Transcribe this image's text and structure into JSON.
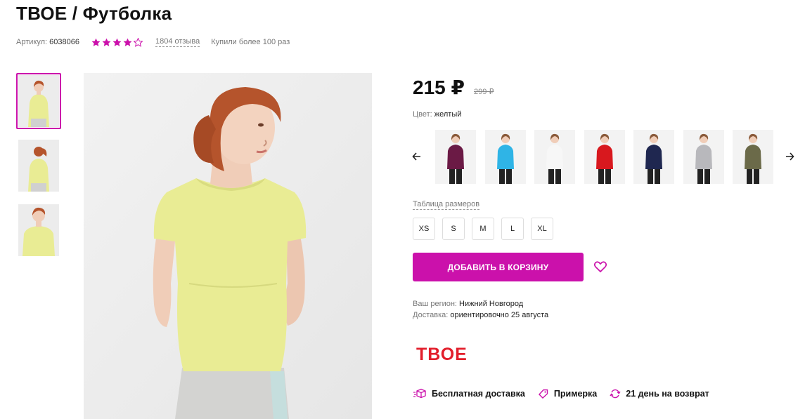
{
  "product": {
    "title": "ТВОЕ / Футболка",
    "article_label": "Артикул:",
    "article": "6038066",
    "rating": 4,
    "rating_max": 5,
    "reviews": "1804 отзыва",
    "bought": "Купили более 100 раз"
  },
  "price": {
    "current": "215 ₽",
    "old": "299 ₽"
  },
  "color": {
    "label": "Цвет:",
    "value": "желтый",
    "swatches": [
      {
        "name": "purple",
        "shirt": "#6b1a45"
      },
      {
        "name": "blue",
        "shirt": "#2fb4e6"
      },
      {
        "name": "white",
        "shirt": "#f7f7f7"
      },
      {
        "name": "red",
        "shirt": "#d8181e"
      },
      {
        "name": "navy",
        "shirt": "#1f2750"
      },
      {
        "name": "gray",
        "shirt": "#b8b8bc"
      },
      {
        "name": "khaki",
        "shirt": "#6b6a49"
      }
    ]
  },
  "sizes": {
    "table_link": "Таблица размеров",
    "options": [
      "XS",
      "S",
      "M",
      "L",
      "XL"
    ]
  },
  "cart": {
    "button": "ДОБАВИТЬ В КОРЗИНУ"
  },
  "delivery": {
    "region_label": "Ваш регион:",
    "region": "Нижний Новгород",
    "delivery_label": "Доставка:",
    "delivery": "ориентировочно 25 августа"
  },
  "brand": {
    "logo_text": "ТВОЕ"
  },
  "perks": [
    {
      "icon": "box-icon",
      "label": "Бесплатная доставка"
    },
    {
      "icon": "tag-icon",
      "label": "Примерка"
    },
    {
      "icon": "return-icon",
      "label": "21 день на возврат"
    }
  ],
  "colors": {
    "accent": "#cb11ab",
    "logo": "#e21e2b",
    "main_shirt": "#e9ec94",
    "hair": "#b5542c",
    "skin": "#f0cdb8"
  }
}
